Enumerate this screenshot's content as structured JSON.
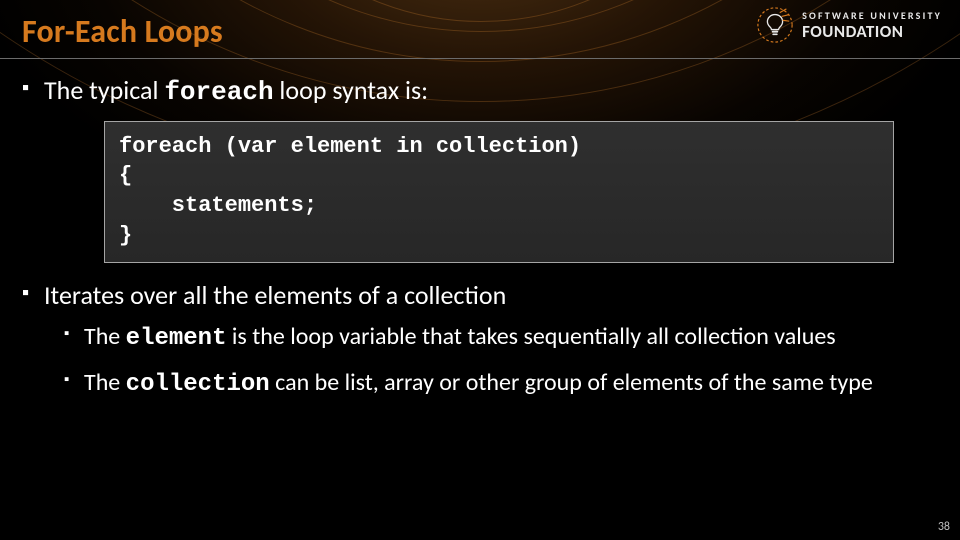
{
  "title": "For-Each Loops",
  "logo": {
    "top": "SOFTWARE UNIVERSITY",
    "bottom": "FOUNDATION"
  },
  "bullet1": {
    "pre": "The typical ",
    "code": "foreach",
    "post": " loop syntax is:"
  },
  "code": {
    "l1": "foreach (var element in collection)",
    "l2": "{",
    "l3": "    statements;",
    "l4": "}"
  },
  "bullet2": "Iterates over all the elements of a collection",
  "sub1": {
    "pre": "The ",
    "code": "element",
    "post": " is the loop variable that takes sequentially all collection values"
  },
  "sub2": {
    "pre": "The ",
    "code": "collection",
    "post": " can be list, array or other group of elements of the same type"
  },
  "page": "38"
}
